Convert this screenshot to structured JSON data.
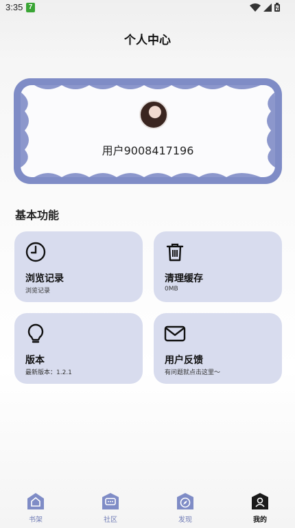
{
  "status_bar": {
    "time": "3:35",
    "app_badge": "7"
  },
  "header": {
    "title": "个人中心"
  },
  "profile": {
    "username": "用户9008417196"
  },
  "section": {
    "title": "基本功能"
  },
  "tiles": [
    {
      "title": "浏览记录",
      "subtitle": "浏览记录",
      "icon": "clock-icon"
    },
    {
      "title": "清理缓存",
      "subtitle": "0MB",
      "icon": "trash-icon"
    },
    {
      "title": "版本",
      "subtitle": "最新版本：1.2.1",
      "icon": "lightbulb-icon"
    },
    {
      "title": "用户反馈",
      "subtitle": "有问题就点击这里～",
      "icon": "envelope-icon"
    }
  ],
  "nav": {
    "items": [
      {
        "label": "书架",
        "icon": "home-icon",
        "active": false
      },
      {
        "label": "社区",
        "icon": "chat-icon",
        "active": false
      },
      {
        "label": "发现",
        "icon": "compass-icon",
        "active": false
      },
      {
        "label": "我的",
        "icon": "user-icon",
        "active": true
      }
    ]
  },
  "colors": {
    "accent": "#7f8cc6",
    "tile_bg": "#d8dcee",
    "nav_inactive": "#6f7bb5"
  }
}
